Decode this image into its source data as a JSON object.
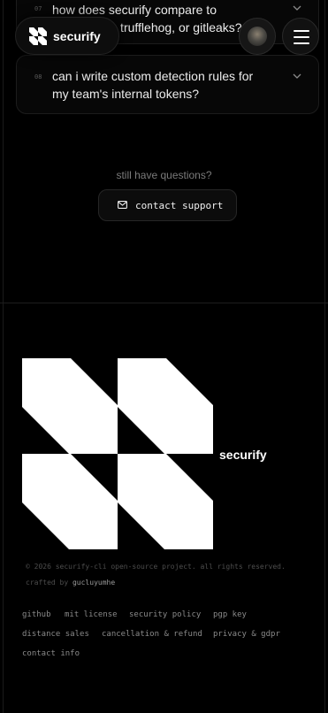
{
  "faq": {
    "items": [
      {
        "number": "07",
        "question_line1": "how does securify compare to",
        "question_line2": "gitguardian, trufflehog, or gitleaks?"
      },
      {
        "number": "08",
        "question_line1": "can i write custom detection rules for",
        "question_line2": "my team's internal tokens?"
      }
    ]
  },
  "header": {
    "brand": "securify",
    "avatar_icon": "user-avatar",
    "menu_icon": "hamburger-menu-icon"
  },
  "support": {
    "prompt": "still have questions?",
    "button_label": "contact support",
    "button_icon": "mail-icon"
  },
  "footer": {
    "brand": "securify",
    "copyright": "© 2026 securify-cli open-source project. all rights reserved.",
    "crafted_prefix": "crafted by ",
    "crafted_author": "gucluyumhe",
    "links": [
      "github",
      "mit license",
      "security policy",
      "pgp key",
      "distance sales",
      "cancellation & refund",
      "privacy & gdpr",
      "contact info"
    ]
  },
  "colors": {
    "background": "#000000",
    "text": "#ececec",
    "muted": "#7a7a7a",
    "border": "#1c1c1c"
  }
}
